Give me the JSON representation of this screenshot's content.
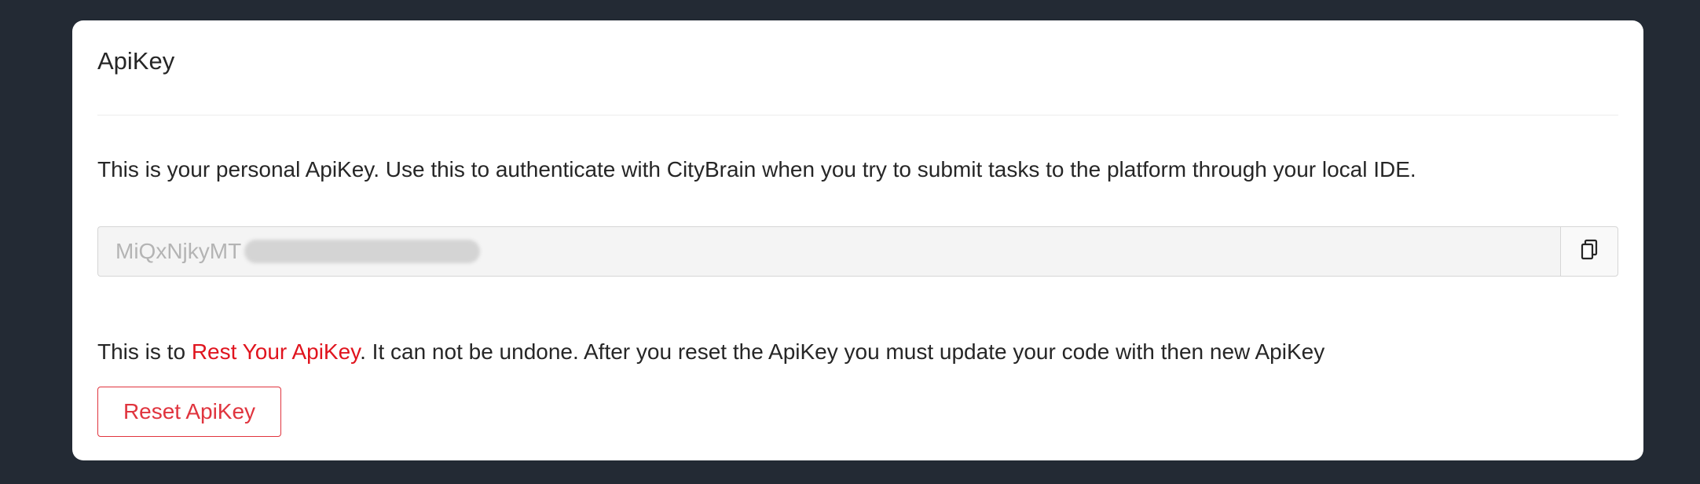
{
  "card": {
    "title": "ApiKey",
    "description": "This is your personal ApiKey. Use this to authenticate with CityBrain when you try to submit tasks to the platform through your local IDE.",
    "api_key": {
      "visible_prefix": "MiQxNjkyMT",
      "redacted": true,
      "copy_icon": "copy-icon"
    },
    "warning": {
      "prefix": "This is to ",
      "link_text": "Rest Your ApiKey",
      "suffix": ". It can not be undone. After you reset the ApiKey you must update your code with then new ApiKey"
    },
    "reset_button_label": "Reset ApiKey"
  },
  "colors": {
    "page_background": "#232a34",
    "card_background": "#ffffff",
    "danger": "#e0343e",
    "highlight_text": "#e0141e"
  }
}
